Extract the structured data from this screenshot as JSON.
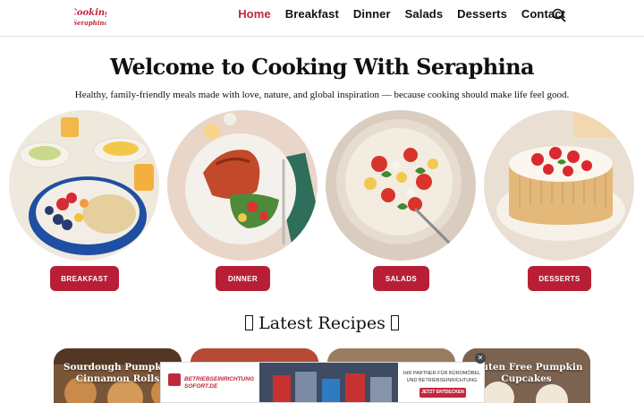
{
  "header": {
    "logo_text_1": "Cooking",
    "logo_text_2": "Seraphina",
    "nav": [
      "Home",
      "Breakfast",
      "Dinner",
      "Salads",
      "Desserts",
      "Contact"
    ],
    "active_index": 0
  },
  "hero": {
    "title": "Welcome to Cooking With Seraphina",
    "subtitle": "Healthy, family-friendly meals made with love, nature, and global inspiration — because cooking should make life feel good."
  },
  "categories": [
    {
      "label": "BREAKFAST"
    },
    {
      "label": "DINNER"
    },
    {
      "label": "SALADS"
    },
    {
      "label": "DESSERTS"
    }
  ],
  "latest": {
    "title": "Latest Recipes"
  },
  "recipes": [
    {
      "title": "Sourdough Pumpkin Cinnamon Rolls"
    },
    {
      "title": ""
    },
    {
      "title": ""
    },
    {
      "title": "Gluten Free Pumpkin Cupcakes"
    }
  ],
  "ad": {
    "brand": "BETRIEBSEINRICHTUNG SOFORT.DE",
    "line1": "IHR PARTNER FÜR BÜROMÖBEL",
    "line2": "UND BETRIEBSEINRICHTUNG",
    "cta": "JETZT ENTDECKEN",
    "close": "✕"
  },
  "colors": {
    "accent": "#c0283c",
    "button": "#b81f36"
  }
}
